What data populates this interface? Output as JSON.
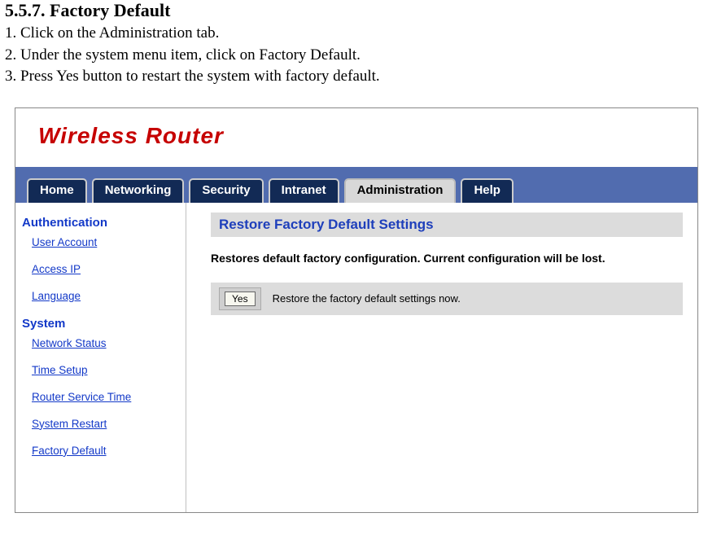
{
  "doc": {
    "heading": "5.5.7. Factory Default",
    "steps": [
      "1. Click on the Administration tab.",
      "2. Under the system menu item, click on Factory Default.",
      "3. Press Yes button to restart the system with factory default."
    ]
  },
  "router": {
    "logo": "Wireless Router",
    "tabs": [
      {
        "label": "Home",
        "active": false
      },
      {
        "label": "Networking",
        "active": false
      },
      {
        "label": "Security",
        "active": false
      },
      {
        "label": "Intranet",
        "active": false
      },
      {
        "label": "Administration",
        "active": true
      },
      {
        "label": "Help",
        "active": false
      }
    ],
    "sidebar": {
      "groups": [
        {
          "title": "Authentication",
          "items": [
            "User Account",
            "Access IP",
            "Language"
          ]
        },
        {
          "title": "System",
          "items": [
            "Network Status",
            "Time Setup",
            "Router Service Time",
            "System Restart",
            "Factory Default"
          ]
        }
      ]
    },
    "panel": {
      "title": "Restore Factory Default Settings",
      "description": "Restores default factory configuration. Current configuration will be lost.",
      "yes_label": "Yes",
      "action_text": "Restore the factory default settings now."
    }
  }
}
